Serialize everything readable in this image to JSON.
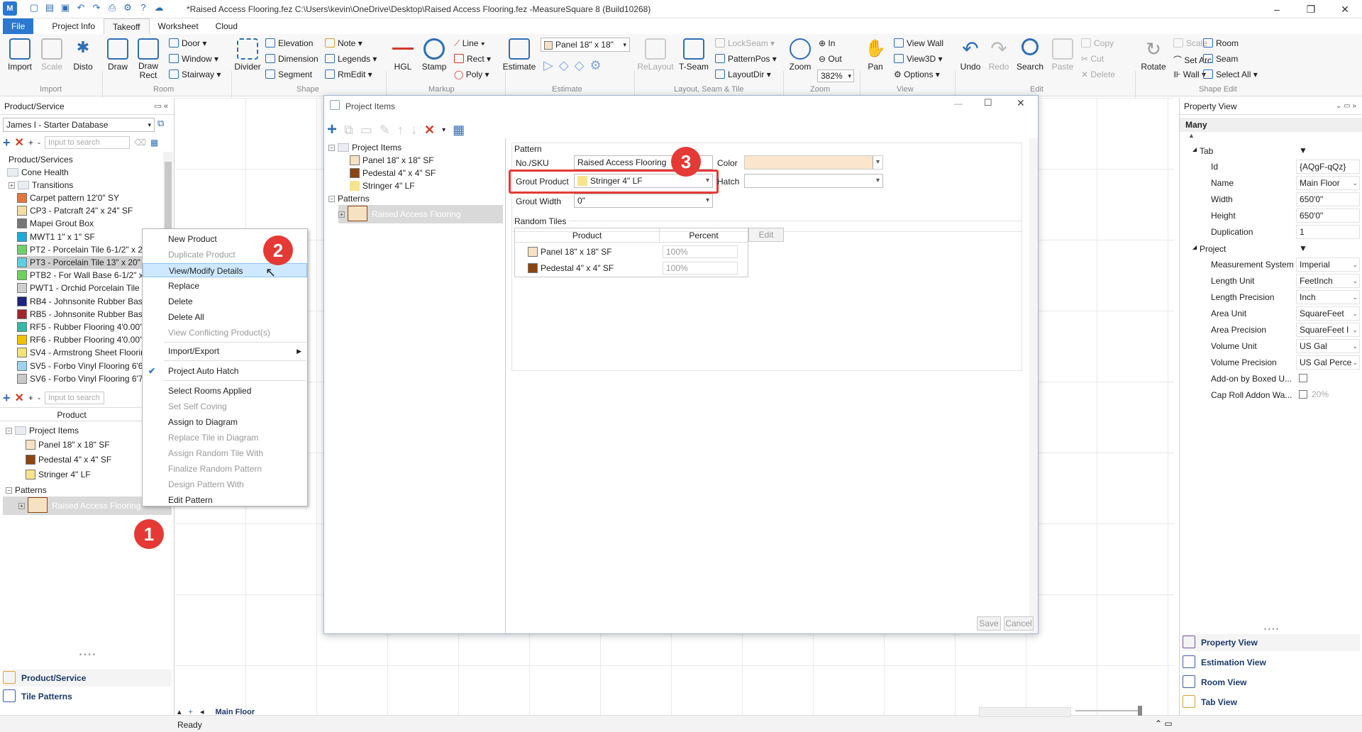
{
  "app": {
    "title": "*Raised Access Flooring.fez C:\\Users\\kevin\\OneDrive\\Desktop\\Raised Access Flooring.fez -MeasureSquare 8 (Build10268)"
  },
  "menu": {
    "tabs": [
      "File",
      "Project Info",
      "Takeoff",
      "Worksheet",
      "Cloud"
    ],
    "active": "Takeoff"
  },
  "ribbon": {
    "import": "Import",
    "scale": "Scale",
    "disto": "Disto",
    "draw": "Draw",
    "draw_rect": "Draw Rect",
    "door": "Door",
    "window": "Window",
    "stairway": "Stairway",
    "divider": "Divider",
    "elevation": "Elevation",
    "dimension": "Dimension",
    "segment": "Segment",
    "note": "Note",
    "legends": "Legends",
    "rmedit": "RmEdit",
    "hgl": "HGL",
    "stamp": "Stamp",
    "line": "Line",
    "rect": "Rect",
    "poly": "Poly",
    "estimate": "Estimate",
    "product_combo": "Panel 18\" x 18\"",
    "relayout": "ReLayout",
    "tseam": "T-Seam",
    "lockseam": "LockSeam",
    "patternpos": "PatternPos",
    "layoutdir": "LayoutDir",
    "zoom": "Zoom",
    "zoom_in": "In",
    "zoom_out": "Out",
    "zoom_level": "382%",
    "pan": "Pan",
    "view_wall": "View Wall",
    "view3d": "View3D",
    "options": "Options",
    "undo": "Undo",
    "redo": "Redo",
    "search": "Search",
    "paste": "Paste",
    "copy": "Copy",
    "cut": "Cut",
    "delete": "Delete",
    "rotate": "Rotate",
    "scale2": "Scale",
    "set_arc": "Set Arc",
    "wall": "Wall",
    "room": "Room",
    "seam": "Seam",
    "select_all": "Select All",
    "groups": {
      "import": "Import",
      "room": "Room",
      "shape": "Shape",
      "markup": "Markup",
      "estimate": "Estimate",
      "layout": "Layout, Seam & Tile",
      "zoom": "Zoom",
      "view": "View",
      "edit": "Edit",
      "shape_edit": "Shape Edit"
    }
  },
  "left_panel": {
    "header": "Product/Service",
    "database": "James I - Starter Database",
    "search_placeholder": "Input to search",
    "tree_root": "Product/Services",
    "folder_cone": "Cone Health",
    "folder_transitions": "Transitions",
    "products": [
      {
        "label": "Carpet pattern 12'0\" SY",
        "color": "#e8743b"
      },
      {
        "label": "CP3 - Patcraft 24\" x 24\" SF",
        "color": "#f3dfa2"
      },
      {
        "label": "Mapei Grout Box",
        "color": "#777777"
      },
      {
        "label": "MWT1 1\" x 1\" SF",
        "color": "#1fa9e1"
      },
      {
        "label": "PT2 - Porcelain Tile 6-1/2\" x 2",
        "color": "#6fd16b"
      },
      {
        "label": "PT3 - Porcelain Tile 13\" x 20\"",
        "color": "#5bd0e0"
      },
      {
        "label": "PTB2 - For Wall Base 6-1/2\" x",
        "color": "#6cd35a"
      },
      {
        "label": "PWT1 - Orchid Porcelain Tile 1",
        "color": "#cfcfcf"
      },
      {
        "label": "RB4 - Johnsonite Rubber Base",
        "color": "#1a237e"
      },
      {
        "label": "RB5 - Johnsonite Rubber Base",
        "color": "#a4262c"
      },
      {
        "label": "RF5 - Rubber Flooring 4'0.00\"",
        "color": "#35b8a8"
      },
      {
        "label": "RF6 - Rubber Flooring 4'0.00\"",
        "color": "#f2c200"
      },
      {
        "label": "SV4 - Armstrong Sheet Floorin",
        "color": "#f3e27a"
      },
      {
        "label": "SV5 - Forbo Vinyl Flooring 6'6",
        "color": "#9ed3f0"
      },
      {
        "label": "SV6 - Forbo Vinyl Flooring 6'7",
        "color": "#c9c9c9"
      }
    ],
    "lower_header": "Product",
    "project_items": "Project Items",
    "items": [
      {
        "label": "Panel 18\" x 18\" SF",
        "color": "#f6e2c2"
      },
      {
        "label": "Pedestal 4\" x 4\" SF",
        "color": "#8b4513"
      },
      {
        "label": "Stringer 4\" LF",
        "color": "#f7e38c"
      }
    ],
    "patterns": "Patterns",
    "pattern_item": "Raised Access Flooring",
    "dock": [
      "Product/Service",
      "Tile Patterns"
    ]
  },
  "context_menu": {
    "items": [
      "New Product",
      "Duplicate Product",
      "View/Modify Details",
      "Replace",
      "Delete",
      "Delete All",
      "View Conflicting Product(s)",
      "Import/Export",
      "Project Auto Hatch",
      "Select Rooms Applied",
      "Set Self Coving",
      "Assign to Diagram",
      "Replace Tile in Diagram",
      "Assign Random Tile With",
      "Finalize Random Pattern",
      "Design Pattern With",
      "Edit Pattern"
    ]
  },
  "dialog": {
    "title": "Project Items",
    "tree_items": "Project Items",
    "tree_item_1": "Panel 18\" x 18\" SF",
    "tree_item_2": "Pedestal 4\" x 4\" SF",
    "tree_item_3": "Stringer 4\" LF",
    "tree_patterns": "Patterns",
    "tree_pattern": "Raised Access Flooring",
    "section": "Pattern",
    "sku_label": "No./SKU",
    "sku_value": "Raised Access Flooring",
    "color_label": "Color",
    "grout_label": "Grout Product",
    "grout_value": "Stringer 4\" LF",
    "hatch_label": "Hatch",
    "grout_width_label": "Grout Width",
    "grout_width_value": "0\"",
    "random_tiles": "Random Tiles",
    "col_product": "Product",
    "col_percent": "Percent",
    "rows": [
      {
        "product": "Panel 18\" x 18\" SF",
        "percent": "100%"
      },
      {
        "product": "Pedestal 4\" x 4\" SF",
        "percent": "100%"
      }
    ],
    "edit": "Edit",
    "save": "Save",
    "cancel": "Cancel"
  },
  "callouts": [
    "1",
    "2",
    "3"
  ],
  "right_panel": {
    "header": "Property View",
    "selection": "Many",
    "tab_group": "Tab",
    "tab_props": [
      {
        "name": "Id",
        "value": "{AQgF-qQz}"
      },
      {
        "name": "Name",
        "value": "Main Floor"
      },
      {
        "name": "Width",
        "value": "650'0\""
      },
      {
        "name": "Height",
        "value": "650'0\""
      },
      {
        "name": "Duplication",
        "value": "1"
      }
    ],
    "project_group": "Project",
    "project_props": [
      {
        "name": "Measurement System",
        "value": "Imperial"
      },
      {
        "name": "Length Unit",
        "value": "FeetInch"
      },
      {
        "name": "Length Precision",
        "value": "Inch"
      },
      {
        "name": "Area Unit",
        "value": "SquareFeet"
      },
      {
        "name": "Area Precision",
        "value": "SquareFeet I"
      },
      {
        "name": "Volume Unit",
        "value": "US Gal"
      },
      {
        "name": "Volume Precision",
        "value": "US Gal Perce"
      },
      {
        "name": "Add-on by Boxed U...",
        "value": ""
      },
      {
        "name": "Cap Roll Addon Wa...",
        "value": "20%"
      }
    ],
    "dock": [
      "Property View",
      "Estimation View",
      "Room View",
      "Tab View"
    ]
  },
  "status": {
    "text": "Ready",
    "tab": "Main Floor"
  },
  "colors": {
    "accent": "#2b78d0",
    "callout": "#e53935",
    "highlight": "#cde8ff"
  }
}
